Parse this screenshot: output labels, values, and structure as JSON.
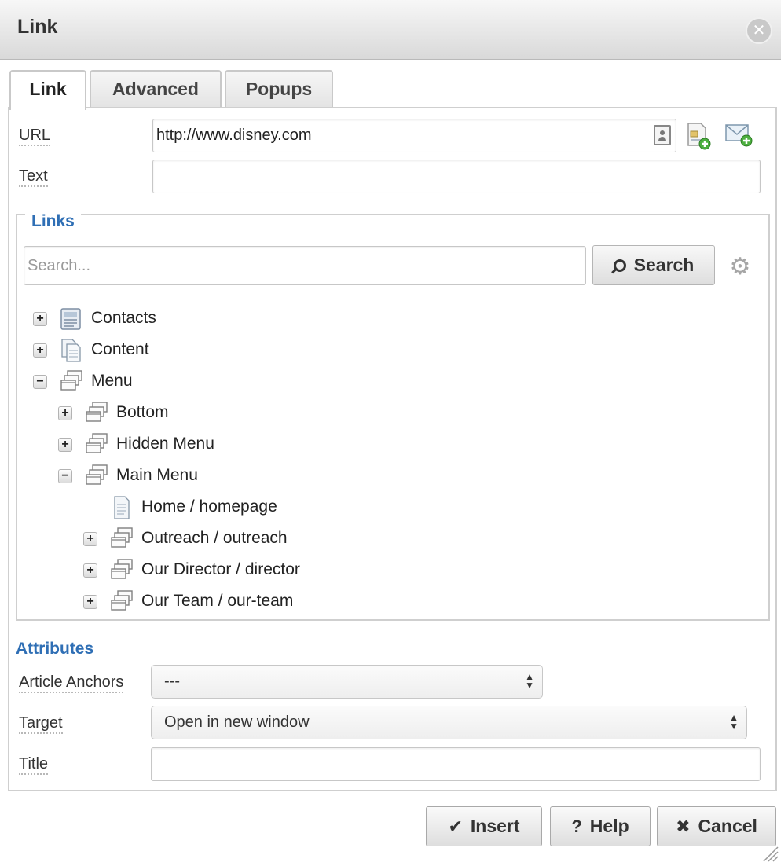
{
  "dialog": {
    "title": "Link",
    "close_glyph": "✕"
  },
  "tabs": [
    {
      "label": "Link",
      "active": true
    },
    {
      "label": "Advanced",
      "active": false
    },
    {
      "label": "Popups",
      "active": false
    }
  ],
  "url": {
    "label": "URL",
    "value": "http://www.disney.com"
  },
  "text": {
    "label": "Text",
    "value": ""
  },
  "links": {
    "legend": "Links",
    "search_placeholder": "Search...",
    "search_button": "Search",
    "tree": [
      {
        "label": "Contacts",
        "toggle": "+",
        "icon": "contacts-icon"
      },
      {
        "label": "Content",
        "toggle": "+",
        "icon": "content-icon"
      },
      {
        "label": "Menu",
        "toggle": "−",
        "icon": "menu-icon"
      },
      {
        "label": "Bottom",
        "toggle": "+",
        "icon": "menu-icon"
      },
      {
        "label": "Hidden Menu",
        "toggle": "+",
        "icon": "menu-icon"
      },
      {
        "label": "Main Menu",
        "toggle": "−",
        "icon": "menu-icon"
      },
      {
        "label": "Home / homepage",
        "toggle": "",
        "icon": "page-icon"
      },
      {
        "label": "Outreach / outreach",
        "toggle": "+",
        "icon": "menu-icon"
      },
      {
        "label": "Our Director / director",
        "toggle": "+",
        "icon": "menu-icon"
      },
      {
        "label": "Our Team / our-team",
        "toggle": "+",
        "icon": "menu-icon"
      }
    ]
  },
  "attributes": {
    "heading": "Attributes",
    "anchors": {
      "label": "Article Anchors",
      "value": "---"
    },
    "target": {
      "label": "Target",
      "value": "Open in new window"
    },
    "title": {
      "label": "Title",
      "value": ""
    }
  },
  "buttons": {
    "insert": "Insert",
    "help": "Help",
    "cancel": "Cancel"
  },
  "colors": {
    "accent": "#2f6fb5"
  }
}
